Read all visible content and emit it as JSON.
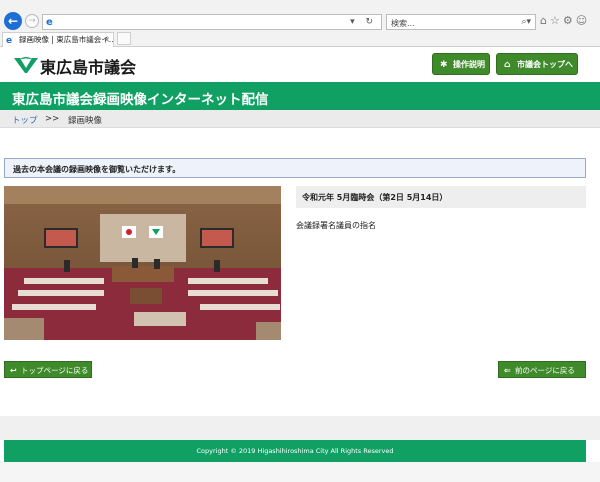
{
  "browser": {
    "address_text": "",
    "search_placeholder": "検索...",
    "tab_title": "録画映像 | 東広島市議会イ...",
    "tab_close": "×"
  },
  "header": {
    "logo_text": "東広島市議会",
    "ops_button": "操作説明",
    "top_button": "市議会トップへ"
  },
  "banner": {
    "title": "東広島市議会録画映像インターネット配信"
  },
  "breadcrumb": {
    "home": "トップ",
    "separator": ">>",
    "current": "録画映像"
  },
  "notice": "過去の本会議の録画映像を御覧いただけます。",
  "meeting": {
    "title": "令和元年 5月臨時会（第2日 5月14日）",
    "agenda_item": "会議録署名議員の指名"
  },
  "buttons": {
    "back_home": "トップページに戻る",
    "back_prev": "前のページに戻る"
  },
  "footer": {
    "copyright": "Copyright © 2019 Higashihiroshima City All Rights Reserved"
  },
  "colors": {
    "brand_green": "#10a064",
    "button_green": "#3f8a2a",
    "link_blue": "#2a6fb8"
  }
}
